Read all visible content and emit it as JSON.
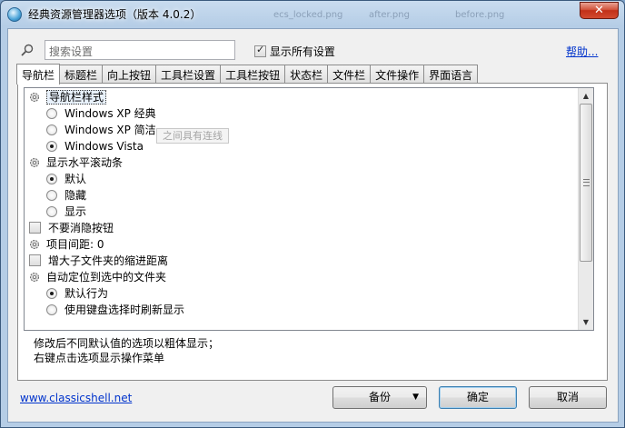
{
  "window": {
    "title": "经典资源管理器选项（版本 4.0.2）",
    "close_label": "✕",
    "background_ghost_texts": [
      "ecs_locked.png",
      "after.png",
      "before.png"
    ]
  },
  "toolbar": {
    "search_placeholder": "搜索设置",
    "show_all_label": "显示所有设置",
    "show_all_checked": true,
    "help_label": "帮助..."
  },
  "tabs": [
    {
      "label": "导航栏",
      "active": true
    },
    {
      "label": "标题栏",
      "active": false
    },
    {
      "label": "向上按钮",
      "active": false
    },
    {
      "label": "工具栏设置",
      "active": false
    },
    {
      "label": "工具栏按钮",
      "active": false
    },
    {
      "label": "状态栏",
      "active": false
    },
    {
      "label": "文件栏",
      "active": false
    },
    {
      "label": "文件操作",
      "active": false
    },
    {
      "label": "界面语言",
      "active": false
    }
  ],
  "settings": {
    "items": [
      {
        "type": "group",
        "label": "导航栏样式"
      },
      {
        "type": "radio",
        "label": "Windows XP 经典",
        "checked": false
      },
      {
        "type": "radio",
        "label": "Windows XP 简洁",
        "checked": false
      },
      {
        "type": "radio",
        "label": "Windows Vista",
        "checked": true
      },
      {
        "type": "group",
        "label": "显示水平滚动条"
      },
      {
        "type": "radio",
        "label": "默认",
        "checked": true
      },
      {
        "type": "radio",
        "label": "隐藏",
        "checked": false
      },
      {
        "type": "radio",
        "label": "显示",
        "checked": false
      },
      {
        "type": "checkbox",
        "label": "不要消隐按钮",
        "checked": false
      },
      {
        "type": "group",
        "label": "项目间距: 0"
      },
      {
        "type": "checkbox",
        "label": "增大子文件夹的缩进距离",
        "checked": false
      },
      {
        "type": "group",
        "label": "自动定位到选中的文件夹"
      },
      {
        "type": "radio",
        "label": "默认行为",
        "checked": true
      },
      {
        "type": "radio",
        "label": "使用键盘选择时刷新显示",
        "checked": false
      }
    ],
    "tooltip": "之间具有连线"
  },
  "notes": {
    "line1": "修改后不同默认值的选项以粗体显示；",
    "line2": "右键点击选项显示操作菜单"
  },
  "footer": {
    "link": "www.classicshell.net",
    "backup_label": "备份",
    "ok_label": "确定",
    "cancel_label": "取消"
  }
}
